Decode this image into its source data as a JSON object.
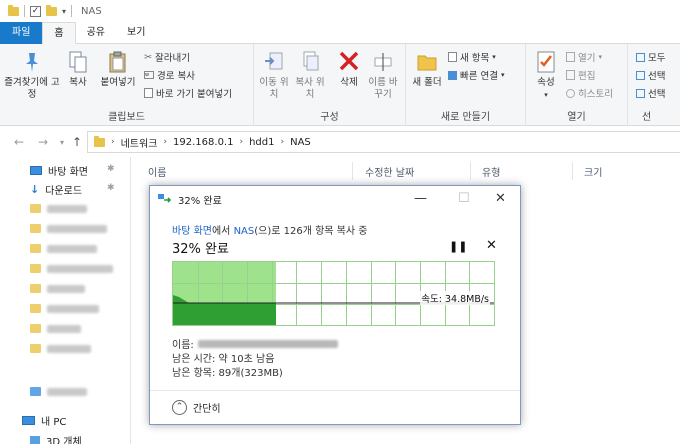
{
  "window": {
    "title": "NAS"
  },
  "ribbon": {
    "tabs": [
      "파일",
      "홈",
      "공유",
      "보기"
    ],
    "clipboard": {
      "pin_label": "즐겨찾기에 고정",
      "copy_label": "복사",
      "paste_label": "붙여넣기",
      "cut_label": "잘라내기",
      "copy_path_label": "경로 복사",
      "paste_shortcut_label": "바로 가기 붙여넣기",
      "group_label": "클립보드"
    },
    "organize": {
      "move_label": "이동 위치",
      "copy_to_label": "복사 위치",
      "delete_label": "삭제",
      "rename_label": "이름 바꾸기",
      "group_label": "구성"
    },
    "new": {
      "new_folder_label": "새 폴더",
      "new_item_label": "새 항목",
      "easy_access_label": "빠른 연결",
      "group_label": "새로 만들기"
    },
    "open": {
      "properties_label": "속성",
      "open_label": "열기",
      "edit_label": "편집",
      "history_label": "히스토리",
      "group_label": "열기"
    },
    "select": {
      "select_all_label": "모두",
      "select_none_label": "선택",
      "invert_label": "선택",
      "group_label": "선"
    }
  },
  "address": {
    "crumbs": [
      "네트워크",
      "192.168.0.1",
      "hdd1",
      "NAS"
    ]
  },
  "nav": {
    "desktop_label": "바탕 화면",
    "downloads_label": "다운로드",
    "this_pc_label": "내 PC",
    "objects3d_label": "3D 개체"
  },
  "columns": {
    "name": "이름",
    "date": "수정한 날짜",
    "type": "유형",
    "size": "크기"
  },
  "dialog": {
    "title": "32% 완료",
    "source": "바탕 화면",
    "from_suffix": "에서 ",
    "dest": "NAS",
    "summary_suffix": "(으)로 126개 항목 복사 중",
    "percent_label": "32% 완료",
    "progress": 0.32,
    "speed_label": "속도: 34.8MB/s",
    "name_label": "이름:",
    "time_left_label": "남은 시간: 약 10초 남음",
    "items_left_label": "남은 항목: 89개(323MB)",
    "less_details_label": "간단히",
    "colors": {
      "fill": "#9ee38b",
      "area": "#2f9e33",
      "grid": "#9ad08f"
    }
  }
}
